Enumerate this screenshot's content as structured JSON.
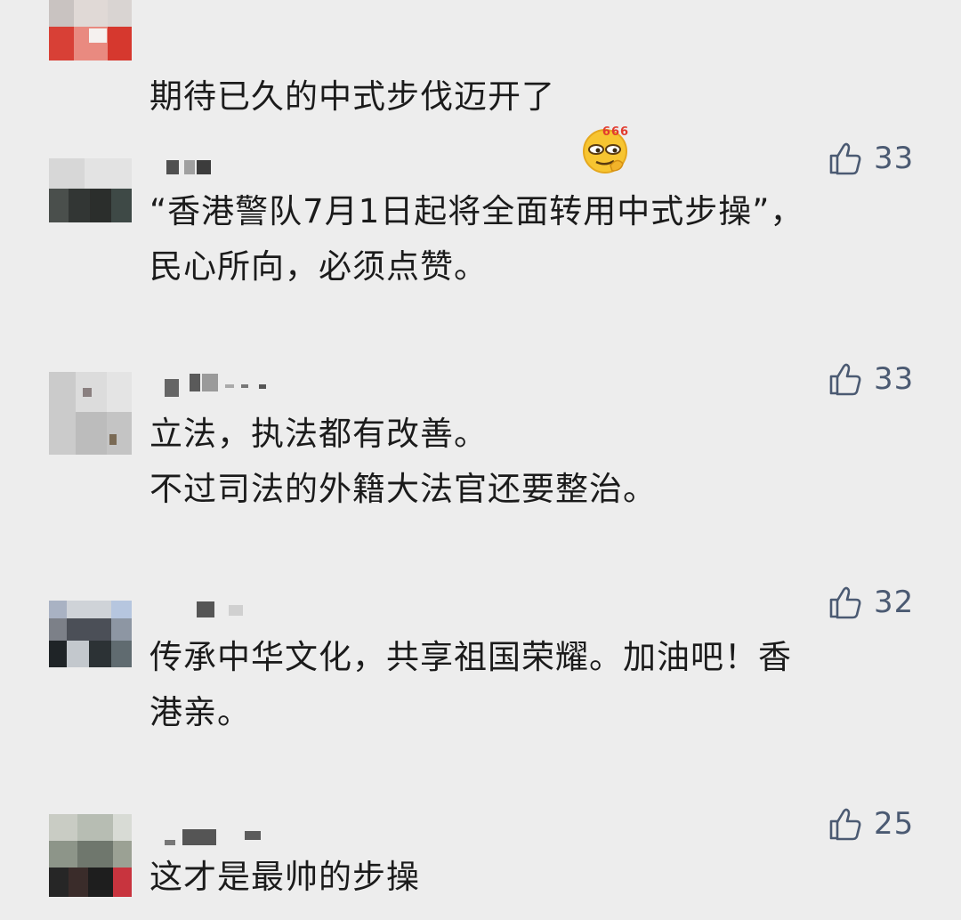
{
  "comments": [
    {
      "text": "期待已久的中式步伐迈开了",
      "emoji": {
        "name": "666-emoji-icon",
        "label": "666"
      }
    },
    {
      "likes": "33",
      "text": "“香港警队7月1日起将全面转用中式步操”，\n民心所向，必须点赞。"
    },
    {
      "likes": "33",
      "text": "立法，执法都有改善。\n不过司法的外籍大法官还要整治。"
    },
    {
      "likes": "32",
      "text": "传承中华文化，共享祖国荣耀。加油吧！香\n港亲。"
    },
    {
      "likes": "25",
      "text": "这才是最帅的步操"
    }
  ],
  "colors": {
    "background": "#ededed",
    "like_blue": "#4b5a72",
    "text": "#1b1b1b"
  },
  "icons": {
    "like": "thumbs-up-icon"
  }
}
